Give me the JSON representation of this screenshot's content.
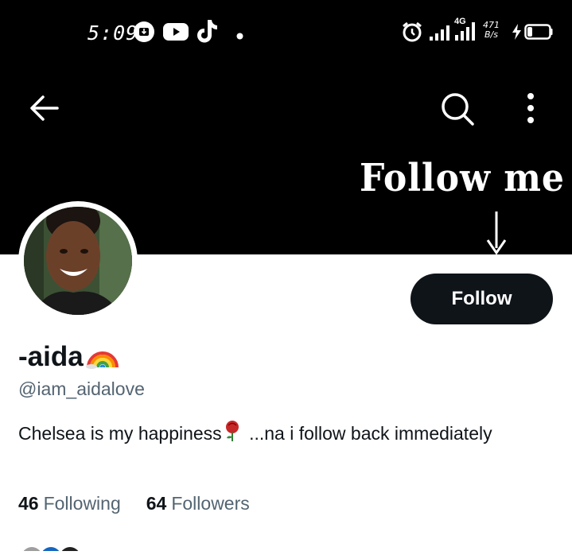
{
  "status_bar": {
    "time": "5:09",
    "network_type": "4G",
    "net_speed_value": "471",
    "net_speed_unit": "B/s",
    "icons": [
      "download-icon",
      "youtube-icon",
      "tiktok-icon",
      "dot-icon",
      "alarm-icon",
      "signal-icon",
      "signal-4g-icon",
      "charging-icon",
      "battery-icon"
    ]
  },
  "banner": {
    "text": "Follow me",
    "icons": [
      "back-arrow-icon",
      "search-icon",
      "more-vertical-icon",
      "arrow-down-icon"
    ]
  },
  "profile": {
    "follow_label": "Follow",
    "display_name": "-aida",
    "name_emoji": "rainbow",
    "handle": "@iam_aidalove",
    "bio_part1": "Chelsea is my happiness",
    "bio_emoji": "rose",
    "bio_part2": " ...na i follow back immediately",
    "following_count": "46",
    "following_label": "Following",
    "followers_count": "64",
    "followers_label": "Followers"
  },
  "colors": {
    "banner_bg": "#000000",
    "follow_button_bg": "#0f1419",
    "secondary_text": "#536471",
    "primary_text": "#0f1419"
  }
}
